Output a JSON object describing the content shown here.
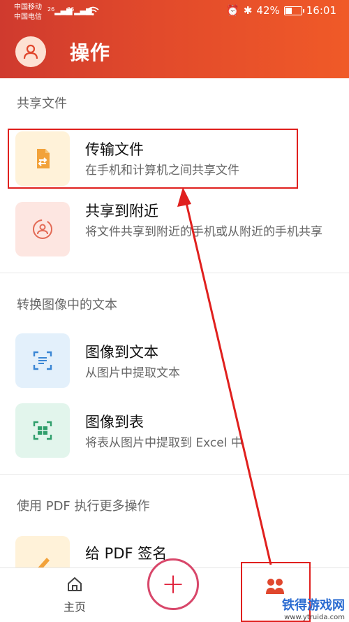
{
  "status_bar": {
    "carrier_1": "中国移动",
    "carrier_2": "中国电信",
    "sig_1": "26",
    "sig_2": "36",
    "battery": "42%",
    "time": "16:01"
  },
  "header": {
    "title": "操作"
  },
  "sections": [
    {
      "title": "共享文件"
    },
    {
      "title": "转换图像中的文本"
    },
    {
      "title": "使用 PDF 执行更多操作"
    }
  ],
  "items": [
    {
      "title": "传输文件",
      "subtitle": "在手机和计算机之间共享文件",
      "icon": "transfer-file-icon"
    },
    {
      "title": "共享到附近",
      "subtitle": "将文件共享到附近的手机或从附近的手机共享",
      "icon": "nearby-share-icon"
    },
    {
      "title": "图像到文本",
      "subtitle": "从图片中提取文本",
      "icon": "image-to-text-icon"
    },
    {
      "title": "图像到表",
      "subtitle": "将表从图片中提取到 Excel 中",
      "icon": "image-to-table-icon"
    },
    {
      "title": "给 PDF 签名",
      "subtitle": "",
      "icon": "pen-icon"
    }
  ],
  "bottom_nav": {
    "home_label": "主页"
  },
  "watermark": {
    "brand": "铁得游戏网",
    "url": "www.ytruida.com"
  },
  "colors": {
    "accent": "#e24a2b",
    "highlight": "#e0201e"
  }
}
